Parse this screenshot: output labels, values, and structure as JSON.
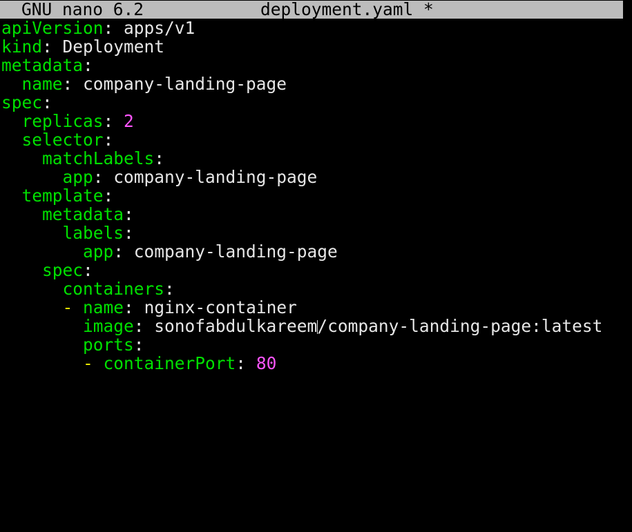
{
  "title_bar": {
    "app": "GNU nano 6.2",
    "file": "deployment.yaml *"
  },
  "lines": [
    {
      "indent": "",
      "dash": "",
      "key": "apiVersion",
      "sep": ": ",
      "value": "apps/v1",
      "num": ""
    },
    {
      "indent": "",
      "dash": "",
      "key": "kind",
      "sep": ": ",
      "value": "Deployment",
      "num": ""
    },
    {
      "indent": "",
      "dash": "",
      "key": "metadata",
      "sep": ":",
      "value": "",
      "num": ""
    },
    {
      "indent": "  ",
      "dash": "",
      "key": "name",
      "sep": ": ",
      "value": "company-landing-page",
      "num": ""
    },
    {
      "indent": "",
      "dash": "",
      "key": "spec",
      "sep": ":",
      "value": "",
      "num": ""
    },
    {
      "indent": "  ",
      "dash": "",
      "key": "replicas",
      "sep": ": ",
      "value": "",
      "num": "2"
    },
    {
      "indent": "  ",
      "dash": "",
      "key": "selector",
      "sep": ":",
      "value": "",
      "num": ""
    },
    {
      "indent": "    ",
      "dash": "",
      "key": "matchLabels",
      "sep": ":",
      "value": "",
      "num": ""
    },
    {
      "indent": "      ",
      "dash": "",
      "key": "app",
      "sep": ": ",
      "value": "company-landing-page",
      "num": ""
    },
    {
      "indent": "  ",
      "dash": "",
      "key": "template",
      "sep": ":",
      "value": "",
      "num": ""
    },
    {
      "indent": "    ",
      "dash": "",
      "key": "metadata",
      "sep": ":",
      "value": "",
      "num": ""
    },
    {
      "indent": "      ",
      "dash": "",
      "key": "labels",
      "sep": ":",
      "value": "",
      "num": ""
    },
    {
      "indent": "        ",
      "dash": "",
      "key": "app",
      "sep": ": ",
      "value": "company-landing-page",
      "num": ""
    },
    {
      "indent": "    ",
      "dash": "",
      "key": "spec",
      "sep": ":",
      "value": "",
      "num": ""
    },
    {
      "indent": "      ",
      "dash": "",
      "key": "containers",
      "sep": ":",
      "value": "",
      "num": ""
    },
    {
      "indent": "      ",
      "dash": "- ",
      "key": "name",
      "sep": ": ",
      "value": "nginx-container",
      "num": ""
    },
    {
      "indent": "        ",
      "dash": "",
      "key": "image",
      "sep": ": ",
      "value": "sonofabdulkareem",
      "cursor": true,
      "value2": "/company-landing-page:latest",
      "num": ""
    },
    {
      "indent": "        ",
      "dash": "",
      "key": "ports",
      "sep": ":",
      "value": "",
      "num": ""
    },
    {
      "indent": "        ",
      "dash": "- ",
      "key": "containerPort",
      "sep": ": ",
      "value": "",
      "num": "80"
    }
  ]
}
